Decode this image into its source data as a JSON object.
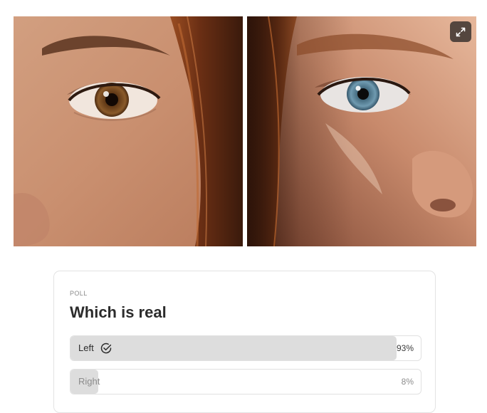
{
  "images": [
    {
      "name": "left-photo",
      "description": "brown-eyed face close-up"
    },
    {
      "name": "right-photo",
      "description": "blue-eyed face close-up"
    }
  ],
  "toolbar": {
    "expand_icon": "expand-icon"
  },
  "poll": {
    "kicker": "POLL",
    "question": "Which is real",
    "options": [
      {
        "label": "Left",
        "percent_text": "93%",
        "percent": 93,
        "selected": true
      },
      {
        "label": "Right",
        "percent_text": "8%",
        "percent": 8,
        "selected": false
      }
    ]
  },
  "colors": {
    "bar_fill": "#dddddd",
    "card_border": "#e3e3e3",
    "muted_text": "#8c8c8c"
  }
}
